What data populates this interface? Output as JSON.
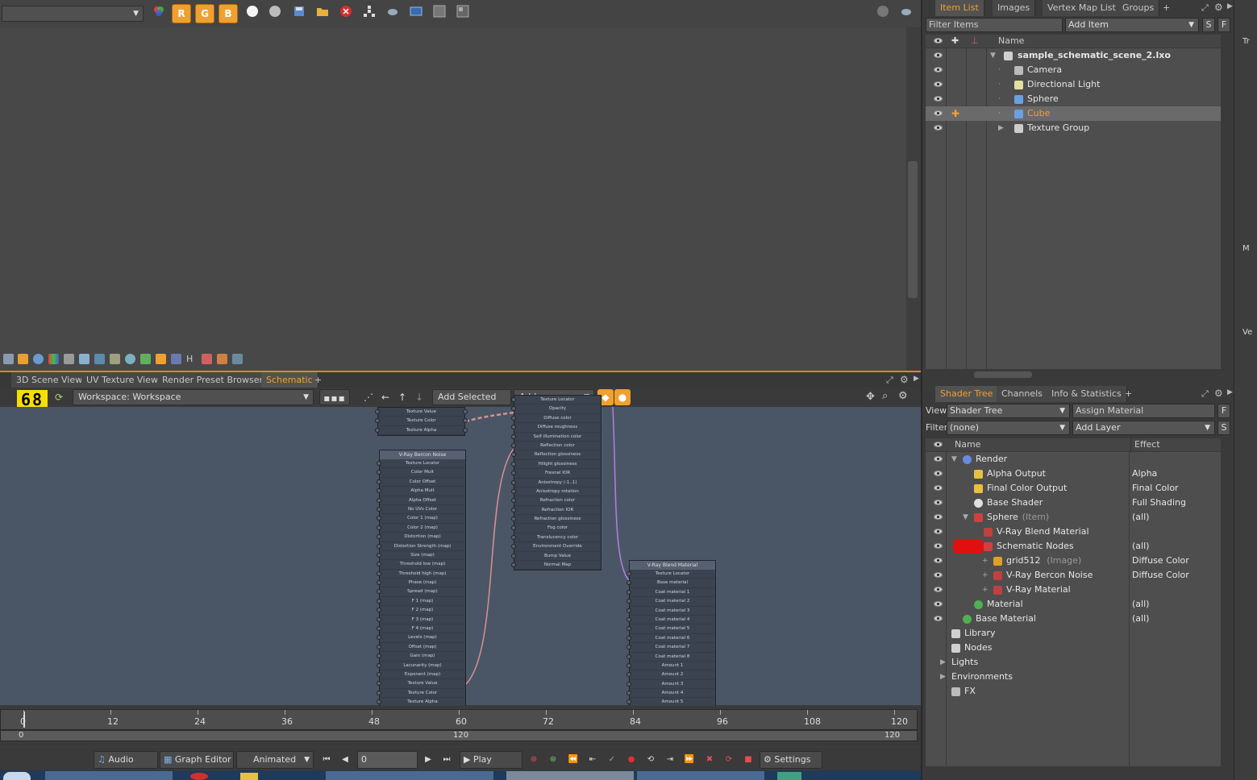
{
  "toolbar": {
    "preset_dropdown": "",
    "rgb": [
      "R",
      "G",
      "B"
    ]
  },
  "viewport_tabs": [
    "3D Scene View",
    "UV Texture View",
    "Render Preset Browser",
    "Schematic"
  ],
  "viewport_tab_add": "+",
  "schematic": {
    "counter": "68",
    "workspace": "Workspace: Workspace",
    "add_selected": "Add Selected",
    "add": "Add...",
    "nodes": {
      "top_left": {
        "rows": [
          "Texture Value",
          "Texture Color",
          "Texture Alpha"
        ]
      },
      "bercon": {
        "title": "V-Ray Bercon Noise",
        "rows": [
          "Texture Locator",
          "Color Mult",
          "Color Offset",
          "Alpha Mult",
          "Alpha Offset",
          "No UVs Color",
          "Color 1 (map)",
          "Color 2 (map)",
          "Distortion (map)",
          "Distortion Strength (map)",
          "Size (map)",
          "Threshold low (map)",
          "Threshold high (map)",
          "Phase (map)",
          "Spread (map)",
          "F 1 (map)",
          "F 2 (map)",
          "F 3 (map)",
          "F 4 (map)",
          "Levels (map)",
          "Offset (map)",
          "Gain (map)",
          "Lacunarity (map)",
          "Exponent (map)",
          "Texture Value",
          "Texture Color",
          "Texture Alpha"
        ]
      },
      "material": {
        "rows": [
          "Texture Locator",
          "Opacity",
          "Diffuse color",
          "Diffuse roughness",
          "Self illumination color",
          "Reflection color",
          "Reflection glossiness",
          "Hilight glossiness",
          "Fresnel IOR",
          "Anisotropy (-1..1)",
          "Anisotropy rotation",
          "Refraction color",
          "Refraction IOR",
          "Refraction glossiness",
          "Fog color",
          "Translucency color",
          "Environment Override",
          "Bump Value",
          "Normal Map"
        ]
      },
      "blend": {
        "title": "V-Ray Blend Material",
        "rows": [
          "Texture Locator",
          "Base material",
          "Coat material 1",
          "Coat material 2",
          "Coat material 3",
          "Coat material 4",
          "Coat material 5",
          "Coat material 6",
          "Coat material 7",
          "Coat material 8",
          "Amount 1",
          "Amount 2",
          "Amount 3",
          "Amount 4",
          "Amount 5"
        ]
      }
    }
  },
  "timeline": {
    "ticks": [
      "0",
      "12",
      "24",
      "36",
      "48",
      "60",
      "72",
      "84",
      "96",
      "108",
      "120"
    ],
    "range_start": "0",
    "range_mid": "120",
    "range_end": "120"
  },
  "transport": {
    "audio": "Audio",
    "graph_editor": "Graph Editor",
    "animated": "Animated",
    "frame": "0",
    "play": "Play",
    "settings": "Settings"
  },
  "item_list": {
    "tabs": [
      "Item List",
      "Images",
      "Vertex Map List",
      "Groups"
    ],
    "tab_add": "+",
    "filter_placeholder": "Filter Items",
    "add_item": "Add Item",
    "s_btn": "S",
    "f_btn": "F",
    "col_name": "Name",
    "items": [
      {
        "label": "sample_schematic_scene_2.lxo",
        "icon": "scene-icon"
      },
      {
        "label": "Camera",
        "icon": "camera-icon"
      },
      {
        "label": "Directional Light",
        "icon": "light-icon"
      },
      {
        "label": "Sphere",
        "icon": "mesh-icon"
      },
      {
        "label": "Cube",
        "icon": "mesh-icon"
      },
      {
        "label": "Texture Group",
        "icon": "group-icon"
      }
    ]
  },
  "shader_tree": {
    "tabs": [
      "Shader Tree",
      "Channels",
      "Info & Statistics"
    ],
    "tab_add": "+",
    "view_label": "View",
    "view_value": "Shader Tree",
    "assign_material": "Assign Material",
    "f_btn": "F",
    "filter_label": "Filter",
    "filter_value": "(none)",
    "add_layer": "Add Layer",
    "s_btn": "S",
    "col_name": "Name",
    "col_effect": "Effect",
    "rows": [
      {
        "label": "Render",
        "suffix": "",
        "effect": "",
        "icon": "render-icon"
      },
      {
        "label": "Alpha Output",
        "suffix": "",
        "effect": "Alpha",
        "icon": "output-icon"
      },
      {
        "label": "Final Color Output",
        "suffix": "",
        "effect": "Final Color",
        "icon": "output-icon"
      },
      {
        "label": "Base Shader",
        "suffix": "",
        "effect": "Full Shading",
        "icon": "shader-icon"
      },
      {
        "label": "Sphere",
        "suffix": "(Item)",
        "effect": "(all)",
        "icon": "mask-icon"
      },
      {
        "label": "V-Ray Blend Material",
        "suffix": "",
        "effect": "",
        "icon": "vray-icon"
      },
      {
        "label": "Schematic Nodes",
        "suffix": "",
        "effect": "(all)",
        "icon": "mask-icon"
      },
      {
        "label": "grid512",
        "suffix": "(Image)",
        "effect": "Diffuse Color",
        "icon": "image-icon"
      },
      {
        "label": "V-Ray Bercon Noise",
        "suffix": "",
        "effect": "Diffuse Color",
        "icon": "vray-icon"
      },
      {
        "label": "V-Ray Material",
        "suffix": "",
        "effect": "",
        "icon": "vray-icon"
      },
      {
        "label": "Material",
        "suffix": "",
        "effect": "(all)",
        "icon": "material-icon"
      },
      {
        "label": "Base Material",
        "suffix": "",
        "effect": "(all)",
        "icon": "material-icon"
      },
      {
        "label": "Library",
        "suffix": "",
        "effect": "",
        "icon": "folder-icon"
      },
      {
        "label": "Nodes",
        "suffix": "",
        "effect": "",
        "icon": "folder-icon"
      },
      {
        "label": "Lights",
        "suffix": "",
        "effect": "",
        "icon": ""
      },
      {
        "label": "Environments",
        "suffix": "",
        "effect": "",
        "icon": ""
      },
      {
        "label": "FX",
        "suffix": "",
        "effect": "",
        "icon": "fx-icon"
      }
    ]
  },
  "far_right": {
    "labels": [
      "Tr",
      "M",
      "Ve"
    ]
  },
  "colors": {
    "accent": "#f0a030",
    "schematic_bg": "#4a5666",
    "wire_pink": "#d99090",
    "wire_purple": "#b080e0",
    "redaction": "#e01010"
  }
}
